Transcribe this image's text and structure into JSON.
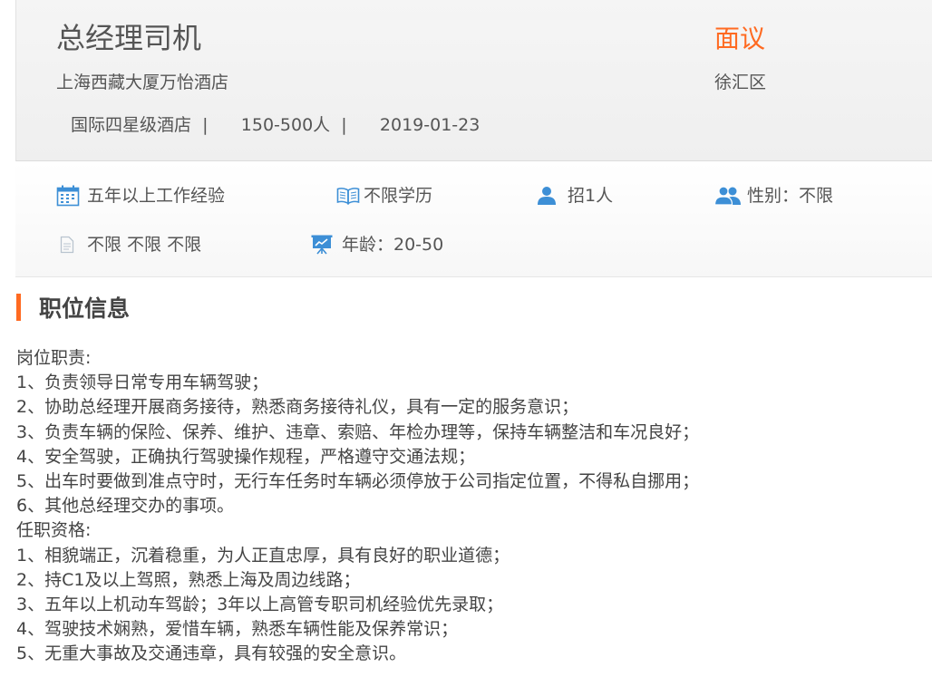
{
  "job": {
    "title": "总经理司机",
    "salary": "面议",
    "company": "上海西藏大厦万怡酒店",
    "district": "徐汇区",
    "company_type": "国际四星级酒店",
    "company_size": "150-500人",
    "publish_date": "2019-01-23",
    "separator": "|"
  },
  "requirements": {
    "experience": "五年以上工作经验",
    "education": "不限学历",
    "headcount": "招1人",
    "gender": "性别：不限",
    "other": "不限 不限 不限",
    "age": "年龄：20-50"
  },
  "section": {
    "title": "职位信息"
  },
  "description": {
    "lines": [
      "岗位职责:",
      "1、负责领导日常专用车辆驾驶；",
      "2、协助总经理开展商务接待，熟悉商务接待礼仪，具有一定的服务意识；",
      "3、负责车辆的保险、保养、维护、违章、索赔、年检办理等，保持车辆整洁和车况良好；",
      "4、安全驾驶，正确执行驾驶操作规程，严格遵守交通法规；",
      "5、出车时要做到准点守时，无行车任务时车辆必须停放于公司指定位置，不得私自挪用；",
      "6、其他总经理交办的事项。",
      "任职资格:",
      "1、相貌端正，沉着稳重，为人正直忠厚，具有良好的职业道德；",
      "2、持C1及以上驾照，熟悉上海及周边线路；",
      "3、五年以上机动车驾龄；3年以上高管专职司机经验优先录取；",
      "4、驾驶技术娴熟，爱惜车辆，熟悉车辆性能及保养常识；",
      "5、无重大事故及交通违章，具有较强的安全意识。"
    ]
  },
  "icons": {
    "experience": "calendar-icon",
    "education": "book-icon",
    "headcount": "person-icon",
    "gender": "people-icon",
    "other": "document-icon",
    "age": "presentation-icon"
  },
  "colors": {
    "accent": "#ff6a21",
    "icon_blue": "#3d8fd6",
    "text": "#555555"
  }
}
